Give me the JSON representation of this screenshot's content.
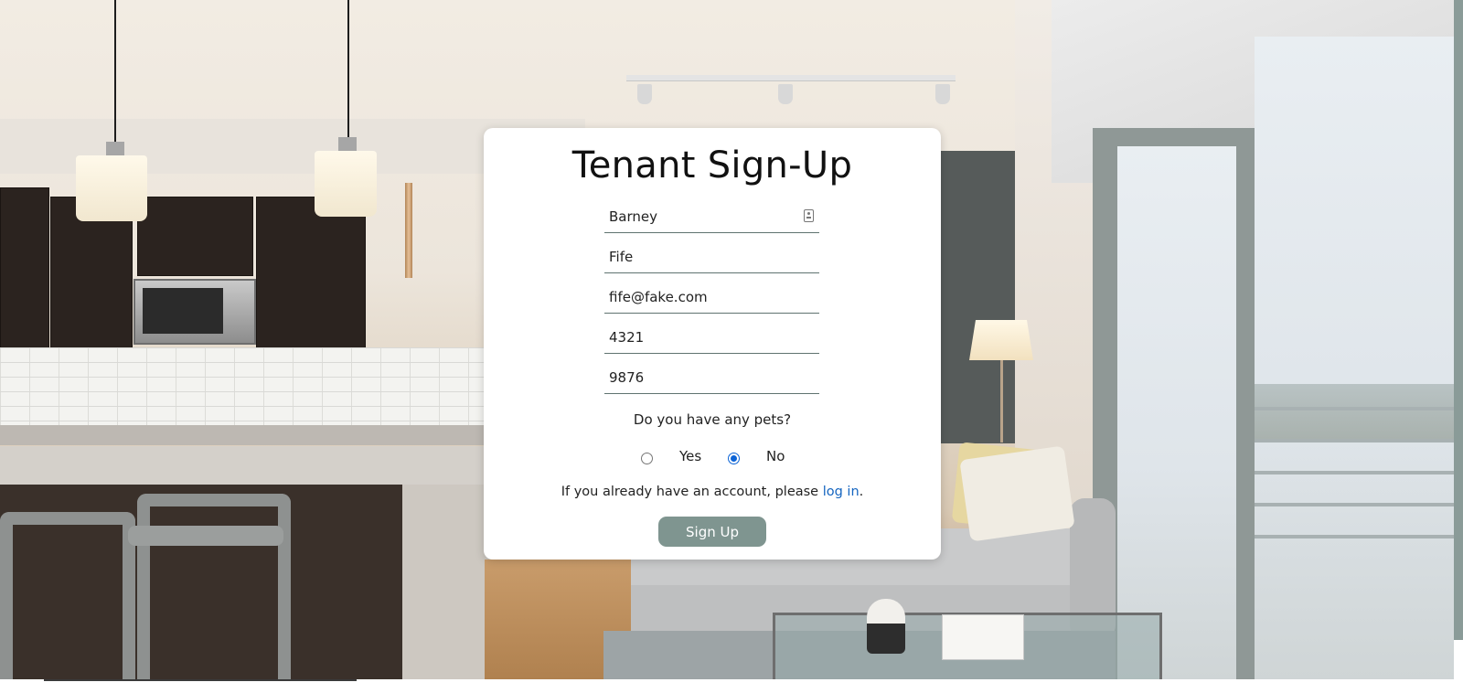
{
  "page": {
    "title": "Tenant Sign-Up"
  },
  "form": {
    "first_name": "Barney",
    "last_name": "Fife",
    "email": "fife@fake.com",
    "field4": "4321",
    "field5": "9876",
    "pets_question": "Do you have any pets?",
    "pets_options": [
      {
        "label": "Yes",
        "selected": false
      },
      {
        "label": "No",
        "selected": true
      }
    ],
    "login_prefix": "If you already have an account, please ",
    "login_link": "log in",
    "login_suffix": ".",
    "submit_label": "Sign Up"
  },
  "colors": {
    "button": "#7f9590",
    "link": "#1565c0",
    "radio_selected": "#0b63d6",
    "field_underline": "#5f7370"
  },
  "icons": {
    "autofill": "contact-card-icon"
  }
}
